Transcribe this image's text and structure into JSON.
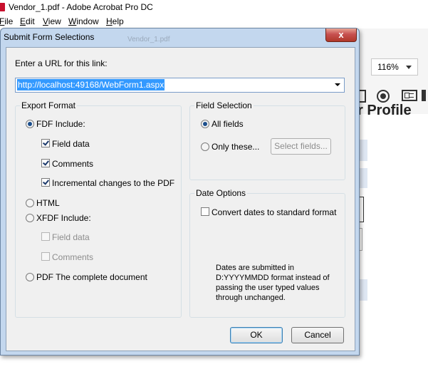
{
  "app": {
    "title": "Vendor_1.pdf - Adobe Acrobat Pro DC",
    "menu": [
      "File",
      "Edit",
      "View",
      "Window",
      "Help"
    ],
    "zoom": "116%",
    "doc_fragment": "r Profile"
  },
  "dialog": {
    "title": "Submit Form Selections",
    "ghost_title": "Vendor_1.pdf",
    "close_label": "x",
    "url_label": "Enter a URL for this link:",
    "url_value": "http://localhost:49168/WebForm1.aspx",
    "export": {
      "title": "Export Format",
      "fdf_label": "FDF  Include:",
      "fdf_selected": true,
      "fdf_field_data": "Field data",
      "fdf_comments": "Comments",
      "fdf_incremental": "Incremental changes to the PDF",
      "html_label": "HTML",
      "xfdf_label": "XFDF  Include:",
      "xfdf_field_data": "Field data",
      "xfdf_comments": "Comments",
      "pdf_label": "PDF  The complete document"
    },
    "field_selection": {
      "title": "Field Selection",
      "all_fields": "All fields",
      "only_these": "Only these...",
      "select_fields_button": "Select fields..."
    },
    "date_options": {
      "title": "Date Options",
      "convert_label": "Convert dates to standard format",
      "info": "Dates are submitted in D:YYYYMMDD format instead of passing the user typed values through unchanged."
    },
    "ok_label": "OK",
    "cancel_label": "Cancel"
  }
}
